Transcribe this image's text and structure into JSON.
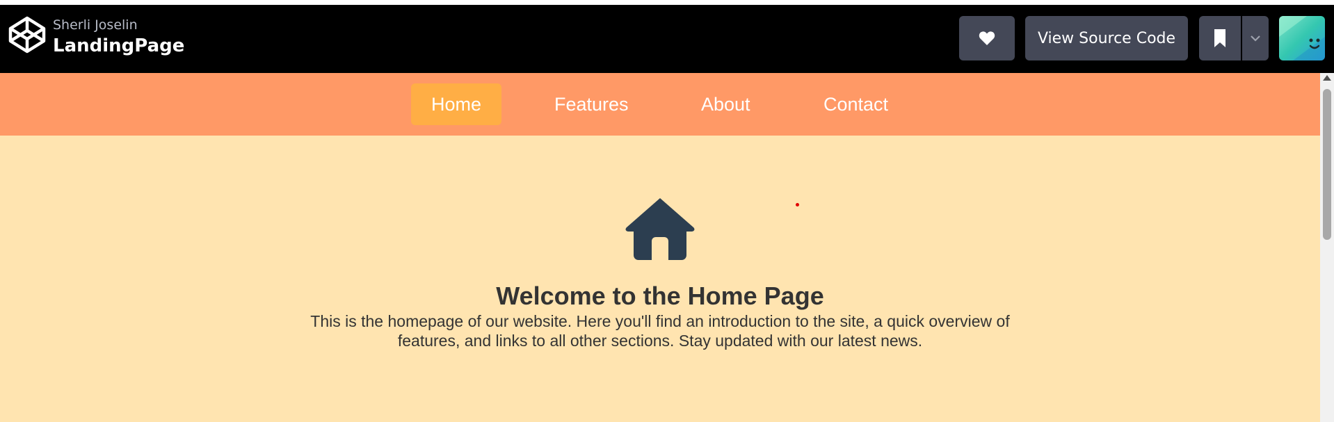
{
  "header": {
    "author": "Sherli Joselin",
    "title": "LandingPage",
    "buttons": {
      "like_icon": "heart-icon",
      "view_source": "View Source Code",
      "bookmark_icon": "bookmark-icon",
      "menu_icon": "chevron-down-icon"
    }
  },
  "nav": {
    "items": [
      {
        "label": "Home",
        "active": true
      },
      {
        "label": "Features",
        "active": false
      },
      {
        "label": "About",
        "active": false
      },
      {
        "label": "Contact",
        "active": false
      }
    ]
  },
  "main": {
    "icon": "home-icon",
    "heading": "Welcome to the Home Page",
    "description": "This is the homepage of our website. Here you'll find an introduction to the site, a quick overview of features, and links to all other sections. Stay updated with our latest news."
  },
  "colors": {
    "topbar": "#000000",
    "nav_bg": "#ff9966",
    "nav_active": "#ffae45",
    "page_bg": "#ffe4b0",
    "icon": "#2c3e50",
    "button_bg": "#444857"
  }
}
